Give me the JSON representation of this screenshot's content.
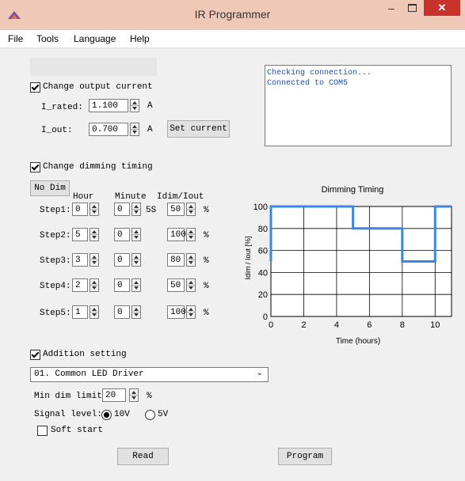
{
  "window": {
    "title": "IR Programmer",
    "minimize": "–",
    "close": "✕"
  },
  "menu": [
    "File",
    "Tools",
    "Language",
    "Help"
  ],
  "output_current": {
    "checkbox_label": "Change output current",
    "checked": true,
    "i_rated_label": "I_rated:",
    "i_rated_value": "1.100",
    "i_rated_unit": "A",
    "i_out_label": "I_out:",
    "i_out_value": "0.700",
    "i_out_unit": "A",
    "set_button": "Set current"
  },
  "log": [
    "Checking connection...",
    "Connected to COM5"
  ],
  "dimming": {
    "checkbox_label": "Change dimming timing",
    "checked": true,
    "no_dim_button": "No Dim",
    "headers": {
      "hour": "Hour",
      "minute": "Minute",
      "idim": "Idim/Iout"
    },
    "steps": [
      {
        "label": "Step1:",
        "hour": "0",
        "minute": "0",
        "extra": "5S",
        "idim": "50",
        "unit": "%"
      },
      {
        "label": "Step2:",
        "hour": "5",
        "minute": "0",
        "extra": "",
        "idim": "100",
        "unit": "%"
      },
      {
        "label": "Step3:",
        "hour": "3",
        "minute": "0",
        "extra": "",
        "idim": "80",
        "unit": "%"
      },
      {
        "label": "Step4:",
        "hour": "2",
        "minute": "0",
        "extra": "",
        "idim": "50",
        "unit": "%"
      },
      {
        "label": "Step5:",
        "hour": "1",
        "minute": "0",
        "extra": "",
        "idim": "100",
        "unit": "%"
      }
    ]
  },
  "chart_data": {
    "type": "line",
    "title": "Dimming Timing",
    "xlabel": "Time (hours)",
    "ylabel": "Idim / Iout [%]",
    "xlim": [
      0,
      11
    ],
    "ylim": [
      0,
      100
    ],
    "xticks": [
      0,
      2,
      4,
      6,
      8,
      10
    ],
    "yticks": [
      0,
      20,
      40,
      60,
      80,
      100
    ],
    "grid": true,
    "series": [
      {
        "color": "#3a86e0",
        "x": [
          0,
          0,
          5,
          5,
          8,
          8,
          10,
          10,
          11
        ],
        "y": [
          50,
          100,
          100,
          80,
          80,
          50,
          50,
          100,
          100
        ]
      }
    ]
  },
  "addition": {
    "checkbox_label": "Addition setting",
    "checked": true,
    "driver_selected": "01. Common LED Driver",
    "min_dim_label": "Min dim limit:",
    "min_dim_value": "20",
    "min_dim_unit": "%",
    "signal_label": "Signal level:",
    "signal_options": [
      "10V",
      "5V"
    ],
    "signal_selected": "10V",
    "soft_start_label": "Soft start",
    "soft_start_checked": false
  },
  "buttons": {
    "read": "Read",
    "program": "Program"
  }
}
